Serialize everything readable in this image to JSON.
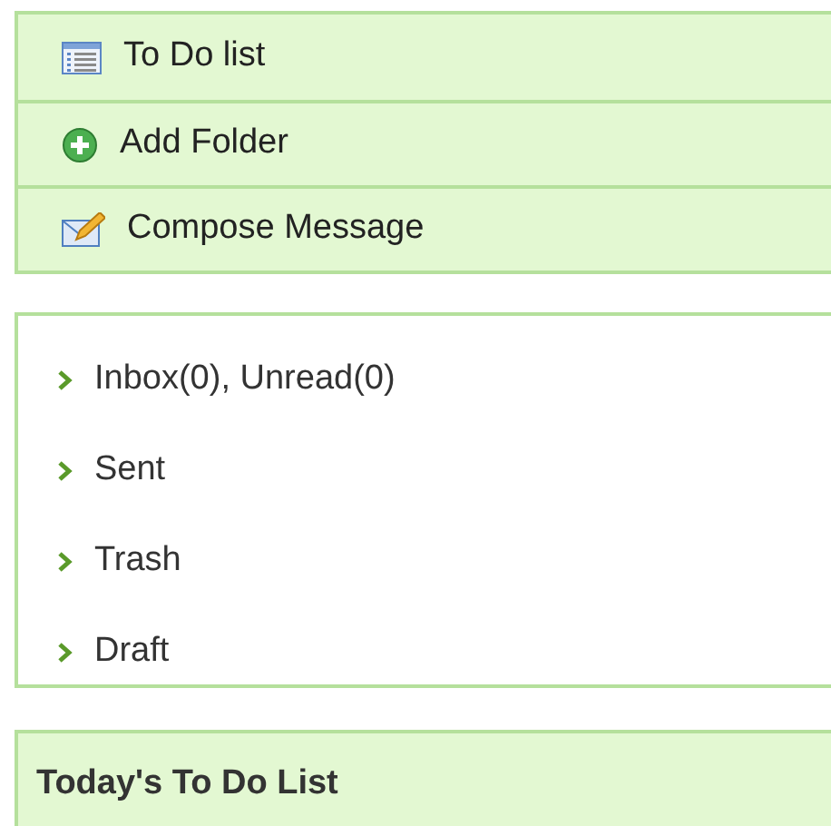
{
  "actions": [
    {
      "kind": "list",
      "label": "To Do list"
    },
    {
      "kind": "add",
      "label": "Add Folder"
    },
    {
      "kind": "compose",
      "label": "Compose Message"
    }
  ],
  "folders": [
    {
      "label": "Inbox(0), Unread(0)"
    },
    {
      "label": "Sent"
    },
    {
      "label": "Trash"
    },
    {
      "label": "Draft"
    }
  ],
  "todo_panel": {
    "title": "Today's To Do List"
  }
}
